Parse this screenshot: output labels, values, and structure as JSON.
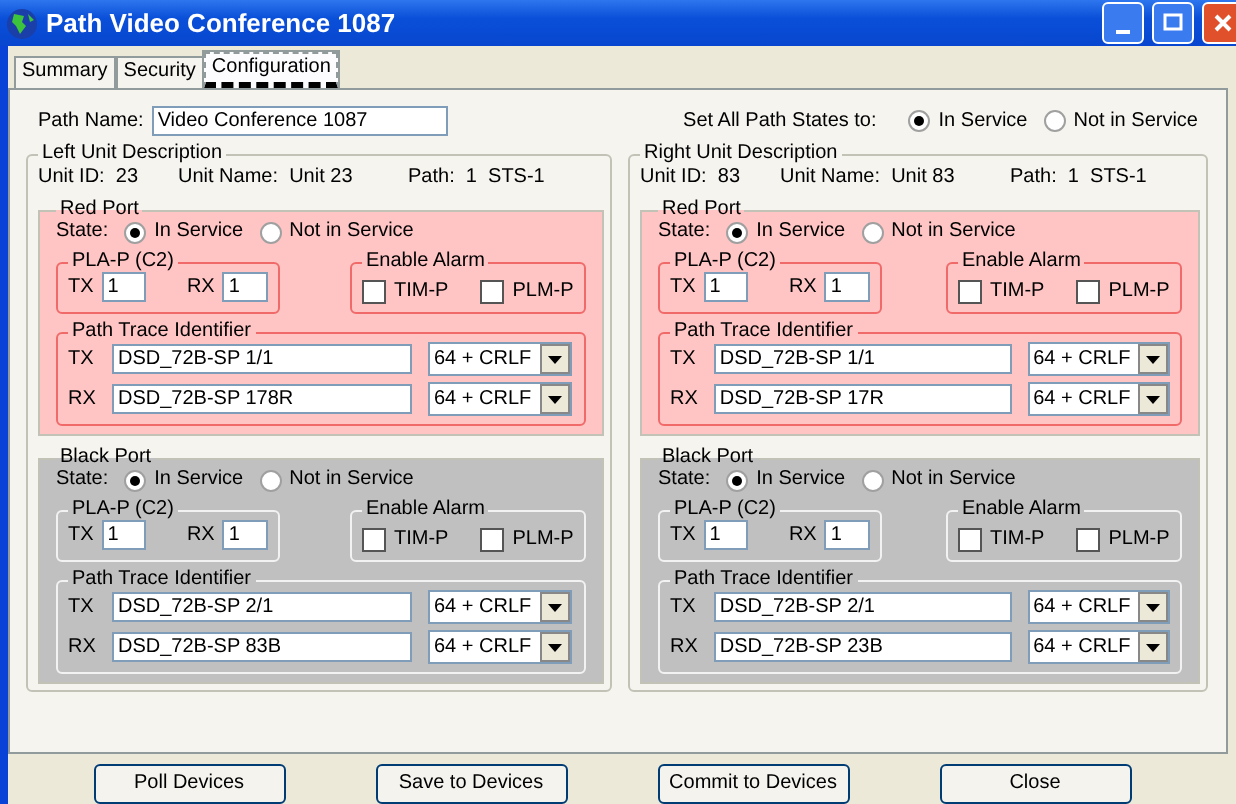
{
  "window": {
    "title": "Path Video Conference 1087"
  },
  "tabs": [
    {
      "label": "Summary",
      "selected": false
    },
    {
      "label": "Security",
      "selected": false
    },
    {
      "label": "Configuration",
      "selected": true
    }
  ],
  "path_name": {
    "label": "Path Name:",
    "value": "Video Conference 1087"
  },
  "set_all": {
    "label": "Set All Path States to:",
    "options": [
      {
        "label": "In Service",
        "selected": true
      },
      {
        "label": "Not in Service",
        "selected": false
      }
    ]
  },
  "units": [
    {
      "title": "Left Unit Description",
      "unit_id_label": "Unit ID:",
      "unit_id": "23",
      "unit_name_label": "Unit Name:",
      "unit_name": "Unit 23",
      "path_label": "Path:",
      "path": "1  STS-1",
      "ports": [
        {
          "title": "Red Port",
          "kind": "red",
          "state_label": "State:",
          "states": [
            {
              "label": "In Service",
              "selected": true
            },
            {
              "label": "Not in Service",
              "selected": false
            }
          ],
          "pla": {
            "title": "PLA-P (C2)",
            "tx_label": "TX",
            "tx": "1",
            "rx_label": "RX",
            "rx": "1"
          },
          "alarm": {
            "title": "Enable Alarm",
            "options": [
              {
                "label": "TIM-P",
                "checked": false
              },
              {
                "label": "PLM-P",
                "checked": false
              }
            ]
          },
          "trace": {
            "title": "Path Trace Identifier",
            "rows": [
              {
                "label": "TX",
                "value": "DSD_72B-SP 1/1",
                "format": "64 + CRLF"
              },
              {
                "label": "RX",
                "value": "DSD_72B-SP 178R",
                "format": "64 + CRLF"
              }
            ]
          }
        },
        {
          "title": "Black Port",
          "kind": "black",
          "state_label": "State:",
          "states": [
            {
              "label": "In Service",
              "selected": true
            },
            {
              "label": "Not in Service",
              "selected": false
            }
          ],
          "pla": {
            "title": "PLA-P (C2)",
            "tx_label": "TX",
            "tx": "1",
            "rx_label": "RX",
            "rx": "1"
          },
          "alarm": {
            "title": "Enable Alarm",
            "options": [
              {
                "label": "TIM-P",
                "checked": false
              },
              {
                "label": "PLM-P",
                "checked": false
              }
            ]
          },
          "trace": {
            "title": "Path Trace Identifier",
            "rows": [
              {
                "label": "TX",
                "value": "DSD_72B-SP 2/1",
                "format": "64 + CRLF"
              },
              {
                "label": "RX",
                "value": "DSD_72B-SP 83B",
                "format": "64 + CRLF"
              }
            ]
          }
        }
      ]
    },
    {
      "title": "Right Unit Description",
      "unit_id_label": "Unit ID:",
      "unit_id": "83",
      "unit_name_label": "Unit Name:",
      "unit_name": "Unit 83",
      "path_label": "Path:",
      "path": "1  STS-1",
      "ports": [
        {
          "title": "Red Port",
          "kind": "red",
          "state_label": "State:",
          "states": [
            {
              "label": "In Service",
              "selected": true
            },
            {
              "label": "Not in Service",
              "selected": false
            }
          ],
          "pla": {
            "title": "PLA-P (C2)",
            "tx_label": "TX",
            "tx": "1",
            "rx_label": "RX",
            "rx": "1"
          },
          "alarm": {
            "title": "Enable Alarm",
            "options": [
              {
                "label": "TIM-P",
                "checked": false
              },
              {
                "label": "PLM-P",
                "checked": false
              }
            ]
          },
          "trace": {
            "title": "Path Trace Identifier",
            "rows": [
              {
                "label": "TX",
                "value": "DSD_72B-SP 1/1",
                "format": "64 + CRLF"
              },
              {
                "label": "RX",
                "value": "DSD_72B-SP 17R",
                "format": "64 + CRLF"
              }
            ]
          }
        },
        {
          "title": "Black Port",
          "kind": "black",
          "state_label": "State:",
          "states": [
            {
              "label": "In Service",
              "selected": true
            },
            {
              "label": "Not in Service",
              "selected": false
            }
          ],
          "pla": {
            "title": "PLA-P (C2)",
            "tx_label": "TX",
            "tx": "1",
            "rx_label": "RX",
            "rx": "1"
          },
          "alarm": {
            "title": "Enable Alarm",
            "options": [
              {
                "label": "TIM-P",
                "checked": false
              },
              {
                "label": "PLM-P",
                "checked": false
              }
            ]
          },
          "trace": {
            "title": "Path Trace Identifier",
            "rows": [
              {
                "label": "TX",
                "value": "DSD_72B-SP 2/1",
                "format": "64 + CRLF"
              },
              {
                "label": "RX",
                "value": "DSD_72B-SP 23B",
                "format": "64 + CRLF"
              }
            ]
          }
        }
      ]
    }
  ],
  "buttons": [
    "Poll Devices",
    "Save to Devices",
    "Commit to Devices",
    "Close"
  ]
}
